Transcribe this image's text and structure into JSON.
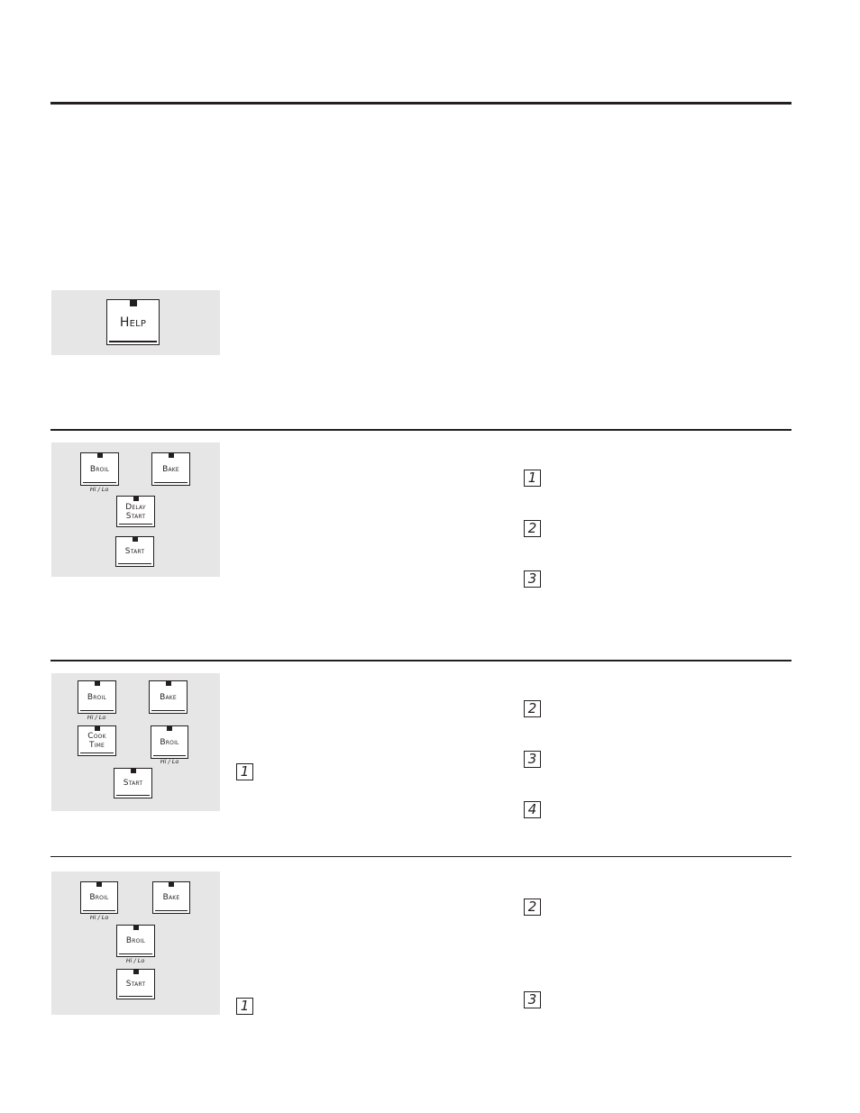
{
  "sections": [
    {
      "id": "help",
      "keys": [
        {
          "label": "Help",
          "sub": ""
        }
      ],
      "steps_left": [],
      "steps_right": []
    },
    {
      "id": "delay-start-broil-bake",
      "keys": [
        {
          "label": "Broil",
          "sub": "Hi / Lo"
        },
        {
          "label": "Bake",
          "sub": ""
        },
        {
          "label": "Delay Start",
          "sub": ""
        },
        {
          "label": "Start",
          "sub": ""
        }
      ],
      "steps_left": [],
      "steps_right": [
        "1",
        "2",
        "3"
      ]
    },
    {
      "id": "cook-time-broil",
      "keys": [
        {
          "label": "Broil",
          "sub": "Hi / Lo"
        },
        {
          "label": "Bake",
          "sub": ""
        },
        {
          "label": "Cook Time",
          "sub": ""
        },
        {
          "label": "Broil",
          "sub": "Hi / Lo"
        },
        {
          "label": "Start",
          "sub": ""
        }
      ],
      "steps_left": [
        "1"
      ],
      "steps_right": [
        "2",
        "3",
        "4"
      ]
    },
    {
      "id": "broil-start",
      "keys": [
        {
          "label": "Broil",
          "sub": "Hi / Lo"
        },
        {
          "label": "Bake",
          "sub": ""
        },
        {
          "label": "Broil",
          "sub": "Hi / Lo"
        },
        {
          "label": "Start",
          "sub": ""
        }
      ],
      "steps_left": [
        "1"
      ],
      "steps_right": [
        "2",
        "3"
      ]
    }
  ],
  "colors": {
    "ink": "#231f20",
    "panel": "#e6e6e6",
    "background": "#ffffff"
  }
}
